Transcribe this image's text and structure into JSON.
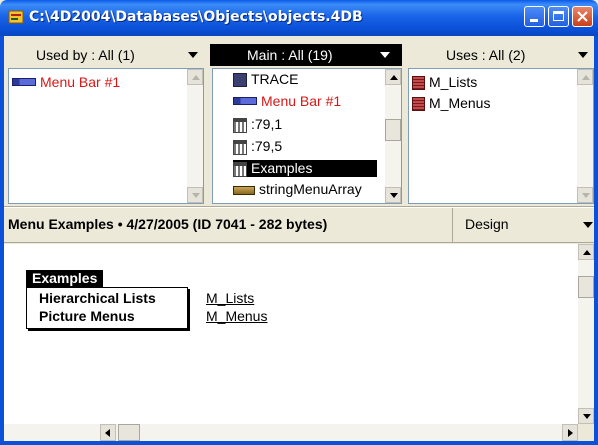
{
  "window": {
    "title": "C:\\4D2004\\Databases\\Objects\\objects.4DB"
  },
  "headers": {
    "used_by": "Used by : All (1)",
    "main": "Main : All (19)",
    "uses": "Uses : All (2)"
  },
  "used_by_list": [
    {
      "label": "Menu Bar #1",
      "icon": "menu-bar-icon"
    }
  ],
  "main_list": [
    {
      "label": "TRACE",
      "icon": "procedure-icon"
    },
    {
      "label": "Menu Bar #1",
      "icon": "menu-bar-icon"
    },
    {
      "label": ":79,1",
      "icon": "form-icon"
    },
    {
      "label": ":79,5",
      "icon": "form-icon"
    },
    {
      "label": "Examples",
      "icon": "form-icon",
      "selected": true
    },
    {
      "label": "stringMenuArray",
      "icon": "string-menu-icon"
    }
  ],
  "uses_list": [
    {
      "label": "M_Lists",
      "icon": "method-icon"
    },
    {
      "label": "M_Menus",
      "icon": "method-icon"
    }
  ],
  "info": {
    "description": "Menu Examples  •  4/27/2005 (ID 7041 - 282 bytes)",
    "mode": "Design"
  },
  "preview": {
    "menu_title": "Examples",
    "menu_items": [
      "Hierarchical Lists",
      "Picture Menus"
    ],
    "methods": [
      "M_Lists",
      "M_Menus"
    ]
  },
  "colors": {
    "title_bar": "#0A5AE8",
    "highlight_text": "#D81818",
    "selection": "#000000"
  }
}
